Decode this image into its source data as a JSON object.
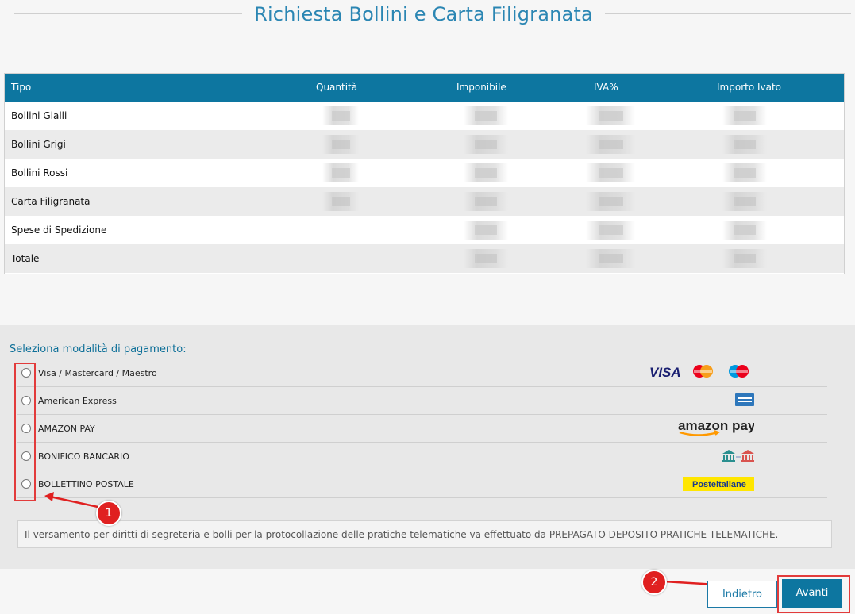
{
  "page": {
    "title": "Richiesta Bollini e Carta Filigranata"
  },
  "table": {
    "headers": [
      "Tipo",
      "Quantità",
      "Imponibile",
      "IVA%",
      "Importo Ivato"
    ],
    "rows": [
      {
        "label": "Bollini Gialli"
      },
      {
        "label": "Bollini Grigi"
      },
      {
        "label": "Bollini Rossi"
      },
      {
        "label": "Carta Filigranata"
      },
      {
        "label": "Spese di Spedizione"
      },
      {
        "label": "Totale"
      }
    ]
  },
  "payment": {
    "title": "Seleziona modalità di pagamento:",
    "options": [
      {
        "label": "Visa / Mastercard / Maestro",
        "logo": "VISA"
      },
      {
        "label": "American Express",
        "logo": "amex-card-icon"
      },
      {
        "label": "AMAZON PAY",
        "logo": "amazon pay"
      },
      {
        "label": "BONIFICO BANCARIO",
        "logo": "bank-transfer-icon"
      },
      {
        "label": "BOLLETTINO POSTALE",
        "logo": "Posteitaliane"
      }
    ],
    "note": "Il versamento per diritti di segreteria e bolli per la protocollazione delle pratiche telematiche va effettuato da PREPAGATO DEPOSITO PRATICHE TELEMATICHE."
  },
  "buttons": {
    "back": "Indietro",
    "next": "Avanti"
  },
  "annotations": {
    "badge1": "1",
    "badge2": "2"
  },
  "colors": {
    "header": "#0d76a0",
    "accent": "#2b86b3",
    "highlight": "#e23b3b"
  }
}
